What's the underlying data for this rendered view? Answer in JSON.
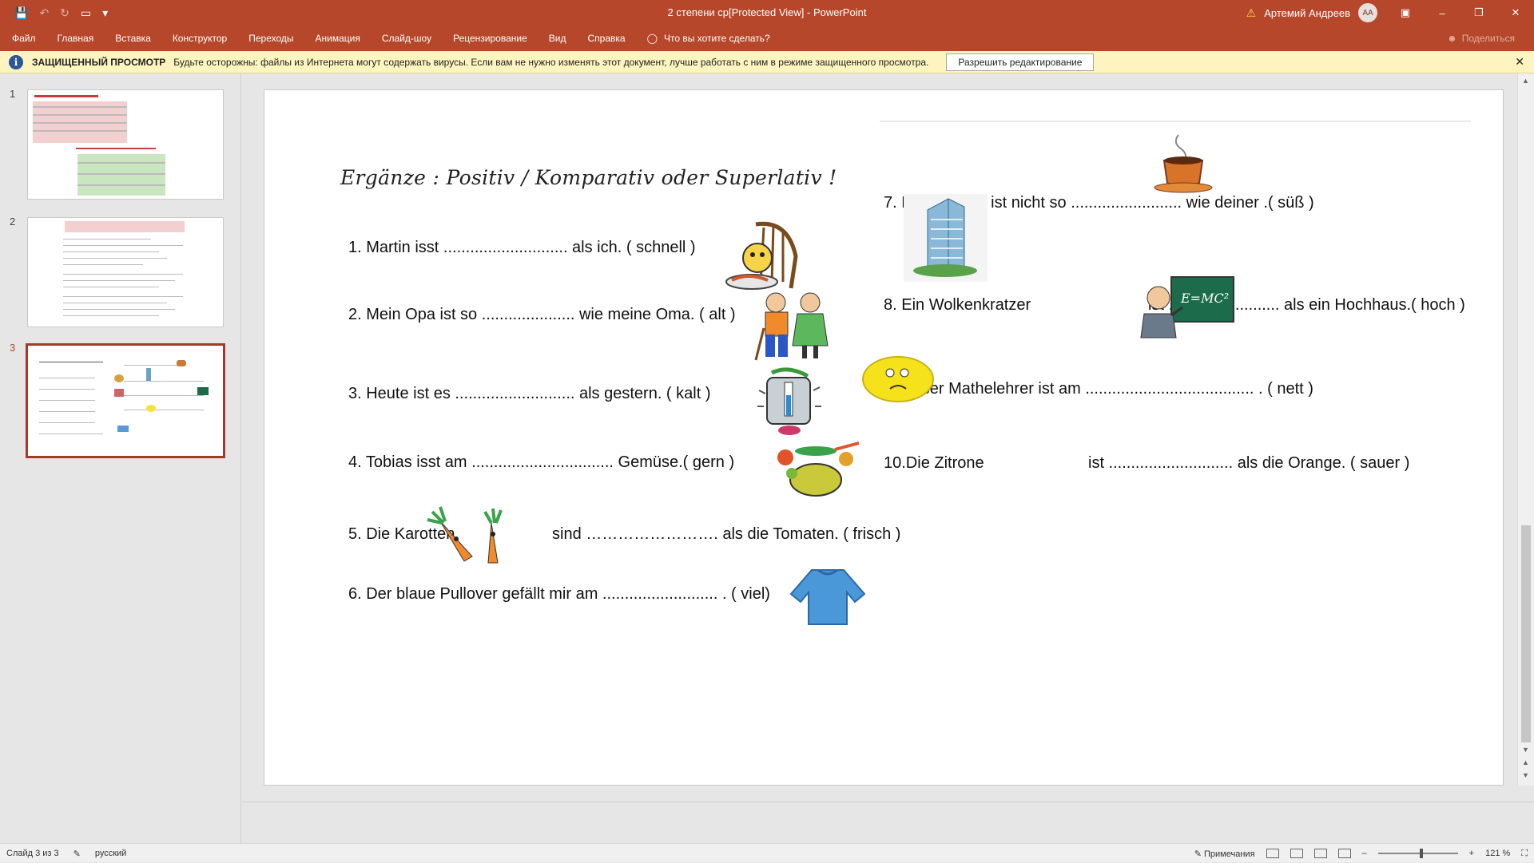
{
  "titlebar": {
    "title": "2 степени ср[Protected View] - PowerPoint",
    "user": "Артемий Андреев",
    "avatar": "АА",
    "qat_icons": [
      "save-icon",
      "undo-icon",
      "redo-icon",
      "start-from-beginning-icon",
      "customize-icon"
    ]
  },
  "ribbon": {
    "tabs": [
      "Файл",
      "Главная",
      "Вставка",
      "Конструктор",
      "Переходы",
      "Анимация",
      "Слайд-шоу",
      "Рецензирование",
      "Вид",
      "Справка"
    ],
    "tell_me": "Что вы хотите сделать?",
    "share": "Поделиться"
  },
  "protected_view": {
    "title": "ЗАЩИЩЕННЫЙ ПРОСМОТР",
    "message": "Будьте осторожны: файлы из Интернета могут содержать вирусы. Если вам не нужно изменять этот документ, лучше работать с ним в режиме защищенного просмотра.",
    "enable_button": "Разрешить редактирование"
  },
  "thumbnails": [
    {
      "number": "1"
    },
    {
      "number": "2"
    },
    {
      "number": "3"
    }
  ],
  "slide": {
    "title": "Ergänze : Positiv / Komparativ  oder Superlativ !",
    "exercises": [
      "1.  Martin isst ............................ als ich. ( schnell )",
      "2.  Mein Opa ist so ..................... wie meine Oma. ( alt )",
      "3.  Heute ist es ........................... als gestern. ( kalt )",
      "4.  Tobias  isst  am  ................................ Gemüse.( gern )",
      "5.  Die Karotten",
      "sind   ……………………. als die Tomaten.  ( frisch )",
      "6.  Der blaue Pullover gefällt  mir am .......................... . ( viel)",
      "7.  Mein Kaffee ist nicht so ......................... wie deiner .( süß )",
      "8.  Ein Wolkenkratzer",
      "ist ......................... als ein Hochhaus.( hoch )",
      "9.  Unser Mathelehrer ist am ...................................... . ( nett )",
      "10.Die  Zitrone",
      "ist ............................ als die Orange. ( sauer )"
    ],
    "formula": "E=MC²"
  },
  "statusbar": {
    "slide_info": "Слайд 3 из 3",
    "language": "русский",
    "notes": "Примечания",
    "zoom": "121 %"
  },
  "colors": {
    "accent": "#b7472a",
    "protected_bar": "#fdf4bf"
  }
}
